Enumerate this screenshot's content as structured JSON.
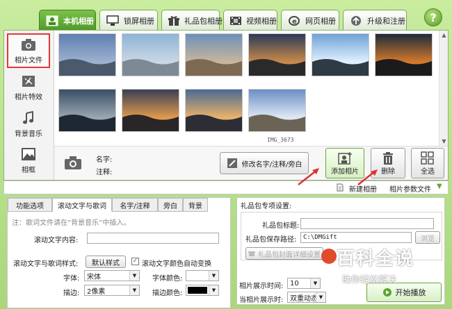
{
  "top_tabs": [
    {
      "label": "本机相册",
      "icon": "album-icon"
    },
    {
      "label": "锁屏相册",
      "icon": "monitor-icon"
    },
    {
      "label": "礼品包相册",
      "icon": "gift-icon"
    },
    {
      "label": "视频相册",
      "icon": "film-icon"
    },
    {
      "label": "网页相册",
      "icon": "ie-icon"
    },
    {
      "label": "升级和注册",
      "icon": "upgrade-icon"
    }
  ],
  "help": {
    "label": "?"
  },
  "sidebar": [
    {
      "label": "相片文件",
      "icon": "camera-icon"
    },
    {
      "label": "相片特效",
      "icon": "effects-icon"
    },
    {
      "label": "背景音乐",
      "icon": "music-note-icon"
    },
    {
      "label": "相框",
      "icon": "picture-frame-icon"
    }
  ],
  "photos": [
    {
      "colors": [
        "#5f7fb0",
        "#9db1cf",
        "#4a5a6c"
      ]
    },
    {
      "colors": [
        "#8fb4d8",
        "#c9d7e4",
        "#7d8a96"
      ]
    },
    {
      "colors": [
        "#6e8fb9",
        "#c7b79c",
        "#7e6a52"
      ]
    },
    {
      "colors": [
        "#2b3a58",
        "#c98a4a",
        "#2a2a2a"
      ]
    },
    {
      "colors": [
        "#6ea2d6",
        "#e1f0ff",
        "#2f3a44"
      ]
    },
    {
      "colors": [
        "#1e2a3a",
        "#d47a2c",
        "#1b1b1b"
      ]
    },
    {
      "colors": [
        "#3b4e66",
        "#9aa7b1",
        "#1e2833"
      ]
    },
    {
      "colors": [
        "#3a3f55",
        "#e09a4d",
        "#2a2526"
      ]
    },
    {
      "colors": [
        "#4a6a92",
        "#e9b26b",
        "#2d2d36"
      ]
    },
    {
      "colors": [
        "#6b8ec6",
        "#dfe8f4",
        "#6c6357"
      ]
    }
  ],
  "selected_photo_caption": "IMG_3673",
  "info": {
    "name_label": "名字:",
    "note_label": "注释:",
    "edit_button": "修改名字/注释/旁白",
    "add_button": "添加相片",
    "delete_button": "删除",
    "select_all_button": "全选"
  },
  "bar2": {
    "new_album": "新建相册",
    "photo_params": "相片参数文件"
  },
  "sub_tabs": [
    "功能选项",
    "滚动文字与歌词",
    "名字/注释",
    "旁白",
    "背景"
  ],
  "lyrics": {
    "note": "注：歌词文件请在“背景音乐”中插入。",
    "content_label": "滚动文字内容:",
    "style_label": "滚动文字与歌词样式:",
    "default_style_button": "默认样式",
    "auto_color_label": "滚动文字颜色自动变换",
    "font_label": "字体:",
    "font_value": "宋体",
    "font_color_label": "字体颜色:",
    "outline_label": "描边:",
    "outline_value": "2像素",
    "outline_color_label": "描边颜色:"
  },
  "gift": {
    "title": "礼品包专项设置:",
    "title_label": "礼品包标题:",
    "path_label": "礼品包保存路径:",
    "path_value": "C:\\DMGift",
    "browse_button": "浏览",
    "cover_button": "礼品包封面详细设置",
    "show_time_label": "相片展示时间:",
    "show_time_value": "10",
    "current_show_label": "当相片展示时:",
    "current_show_value": "双重动态",
    "play_button": "开始播放"
  },
  "watermark": {
    "line1": "百科全说",
    "line2": "助你轻松解决"
  },
  "colors": {
    "accent_green": "#5aa52e",
    "highlight_red": "#e23838",
    "arrow_red": "#e03030"
  }
}
